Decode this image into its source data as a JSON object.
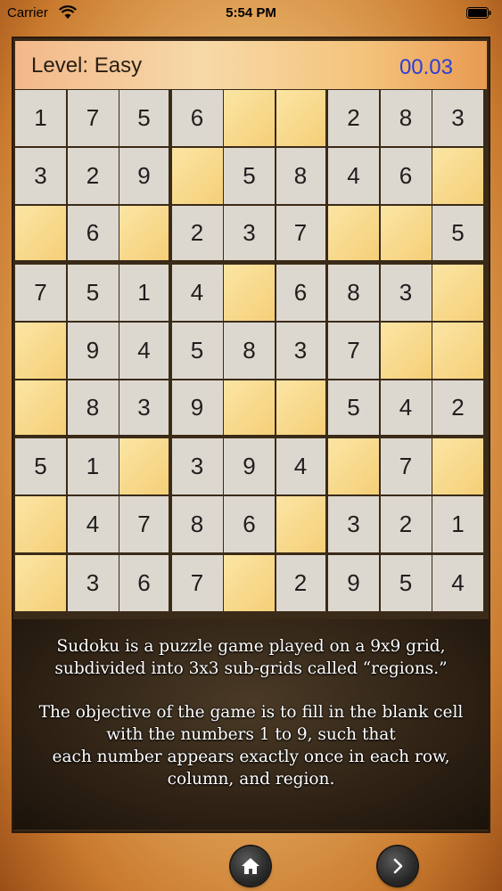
{
  "status": {
    "carrier": "Carrier",
    "time": "5:54 PM"
  },
  "header": {
    "level": "Level: Easy",
    "timer": "00.03"
  },
  "grid": [
    [
      "1",
      "7",
      "5",
      "6",
      "",
      "",
      "2",
      "8",
      "3"
    ],
    [
      "3",
      "2",
      "9",
      "",
      "5",
      "8",
      "4",
      "6",
      ""
    ],
    [
      "",
      "6",
      "",
      "2",
      "3",
      "7",
      "",
      "",
      "5"
    ],
    [
      "7",
      "5",
      "1",
      "4",
      "",
      "6",
      "8",
      "3",
      ""
    ],
    [
      "",
      "9",
      "4",
      "5",
      "8",
      "3",
      "7",
      "",
      ""
    ],
    [
      "",
      "8",
      "3",
      "9",
      "",
      "",
      "5",
      "4",
      "2"
    ],
    [
      "5",
      "1",
      "",
      "3",
      "9",
      "4",
      "",
      "7",
      ""
    ],
    [
      "",
      "4",
      "7",
      "8",
      "6",
      "",
      "3",
      "2",
      "1"
    ],
    [
      "",
      "3",
      "6",
      "7",
      "",
      "2",
      "9",
      "5",
      "4"
    ]
  ],
  "info": {
    "line1": "Sudoku is a puzzle game played on a 9x9 grid,",
    "line2": "subdivided into 3x3 sub-grids called “regions.”",
    "line3": "The objective of the game is to fill in the blank cell",
    "line4": "with the numbers 1 to 9, such that",
    "line5": "each number appears exactly once in each row,",
    "line6": "column, and region."
  },
  "nav": {
    "home_icon": "home-icon",
    "next_icon": "chevron-right-icon"
  },
  "colors": {
    "timer": "#2b3fd6",
    "empty_cell": "#f5cf78",
    "filled_cell": "#ddd8cf"
  }
}
